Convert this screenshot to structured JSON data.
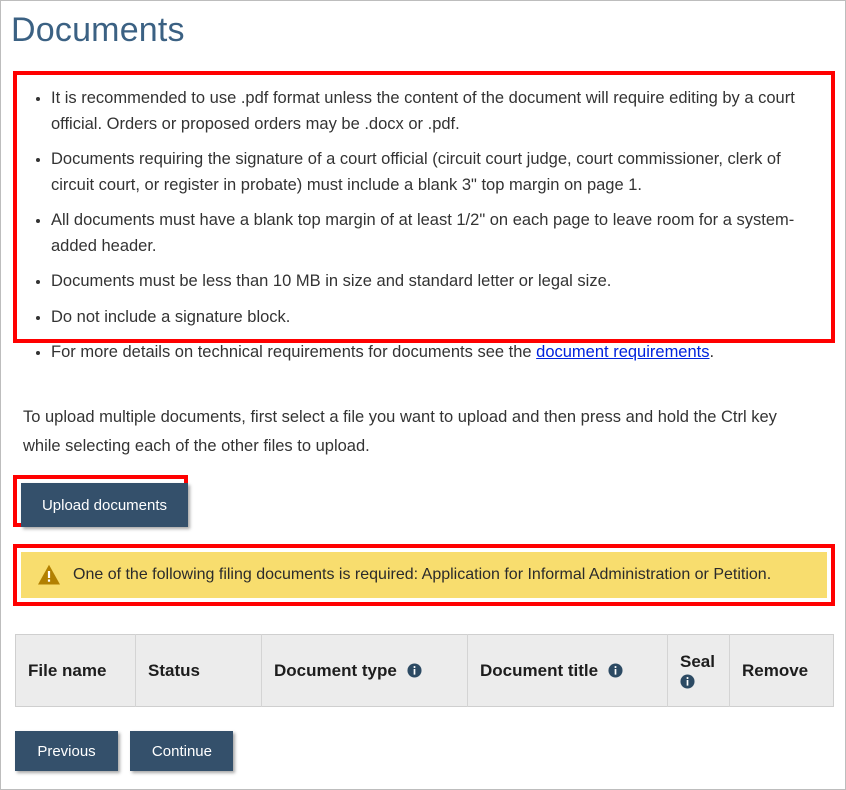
{
  "page": {
    "title": "Documents"
  },
  "requirements": {
    "items": [
      {
        "text": "It is recommended to use .pdf format unless the content of the document will require editing by a court official. Orders or proposed orders may be .docx or .pdf."
      },
      {
        "text": "Documents requiring the signature of a court official (circuit court judge, court commissioner, clerk of circuit court, or register in probate) must include a blank 3\" top margin on page 1."
      },
      {
        "text": "All documents must have a blank top margin of at least 1/2\" on each page to leave room for a system-added header."
      },
      {
        "text": "Documents must be less than 10 MB in size and standard letter or legal size."
      },
      {
        "text": "Do not include a signature block."
      }
    ],
    "last_item": {
      "before_link": "For more details on technical requirements for documents see the ",
      "link_text": "document requirements",
      "after_link": "."
    }
  },
  "instruction": {
    "text": "To upload multiple documents, first select a file you want to upload and then press and hold the Ctrl key while selecting each of the other files to upload."
  },
  "upload": {
    "button_label": "Upload documents"
  },
  "warning": {
    "icon": "warning-triangle-icon",
    "message": "One of the following filing documents is required: Application for Informal Administration or Petition."
  },
  "table": {
    "columns": [
      {
        "label": "File name",
        "info": false
      },
      {
        "label": "Status",
        "info": false
      },
      {
        "label": "Document type",
        "info": true
      },
      {
        "label": "Document title",
        "info": true
      },
      {
        "label": "Seal",
        "info": true
      },
      {
        "label": "Remove",
        "info": false
      }
    ],
    "rows": []
  },
  "footer": {
    "previous_label": "Previous",
    "continue_label": "Continue"
  },
  "colors": {
    "title": "#3b6183",
    "button": "#34506b",
    "highlight": "#ff0000",
    "warning_bg": "#f8dd6e",
    "warning_icon": "#b28000",
    "link": "#0022dd",
    "table_header_bg": "#ececec",
    "info_icon": "#2c4a63"
  }
}
